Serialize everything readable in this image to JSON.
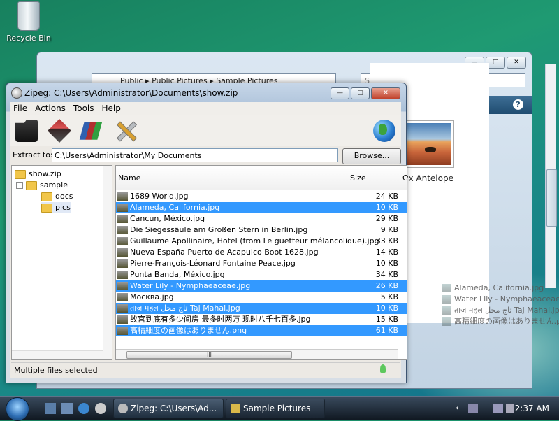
{
  "desktop": {
    "recycle_bin_label": "Recycle Bin"
  },
  "explorer": {
    "address": "Public ▸ Public Pictures ▸ Sample Pictures",
    "search_placeholder": "Search",
    "thumbnail_caption": "Oryx Antelope",
    "drag_items": [
      "Alameda, California.jpg",
      "Water Lily - Nymphaeaceae.jpg",
      "ताज महल تاج محل Taj Mahal.jpg",
      "高精細度の画像はありません.png"
    ]
  },
  "zipeg": {
    "title": "Zipeg: C:\\Users\\Administrator\\Documents\\show.zip",
    "menu": [
      "File",
      "Actions",
      "Tools",
      "Help"
    ],
    "extract_label": "Extract to:",
    "extract_path": "C:\\Users\\Administrator\\My Documents",
    "browse_label": "Browse...",
    "tree": [
      "show.zip",
      "sample",
      "docs",
      "pics"
    ],
    "columns": {
      "name": "Name",
      "size": "Size",
      "more": "C"
    },
    "files": [
      {
        "name": "1689 World.jpg",
        "size": "24 KB",
        "selected": false
      },
      {
        "name": "Alameda, California.jpg",
        "size": "10 KB",
        "selected": true
      },
      {
        "name": "Cancun, México.jpg",
        "size": "29 KB",
        "selected": false
      },
      {
        "name": "Die Siegessäule am Großen Stern in Berlin.jpg",
        "size": "9 KB",
        "selected": false
      },
      {
        "name": "Guillaume Apollinaire, Hotel (from Le guetteur mélancolique).jpg",
        "size": "33 KB",
        "selected": false
      },
      {
        "name": "Nueva España Puerto de Acapulco Boot 1628.jpg",
        "size": "14 KB",
        "selected": false
      },
      {
        "name": "Pierre-François-Léonard Fontaine Peace.jpg",
        "size": "10 KB",
        "selected": false
      },
      {
        "name": "Punta Banda, México.jpg",
        "size": "34 KB",
        "selected": false
      },
      {
        "name": "Water Lily - Nymphaeaceae.jpg",
        "size": "26 KB",
        "selected": true
      },
      {
        "name": "Москва.jpg",
        "size": "5 KB",
        "selected": false
      },
      {
        "name": "ताज महल تاج محل Taj Mahal.jpg",
        "size": "10 KB",
        "selected": true
      },
      {
        "name": "故宫到底有多少间房 最多时两万 现时八千七百多.jpg",
        "size": "15 KB",
        "selected": false
      },
      {
        "name": "高精細度の画像はありません.png",
        "size": "61 KB",
        "selected": true
      }
    ],
    "status": "Multiple files selected"
  },
  "taskbar": {
    "tasks": [
      "Zipeg: C:\\Users\\Ad...",
      "Sample Pictures"
    ],
    "clock": "2:37 AM"
  }
}
